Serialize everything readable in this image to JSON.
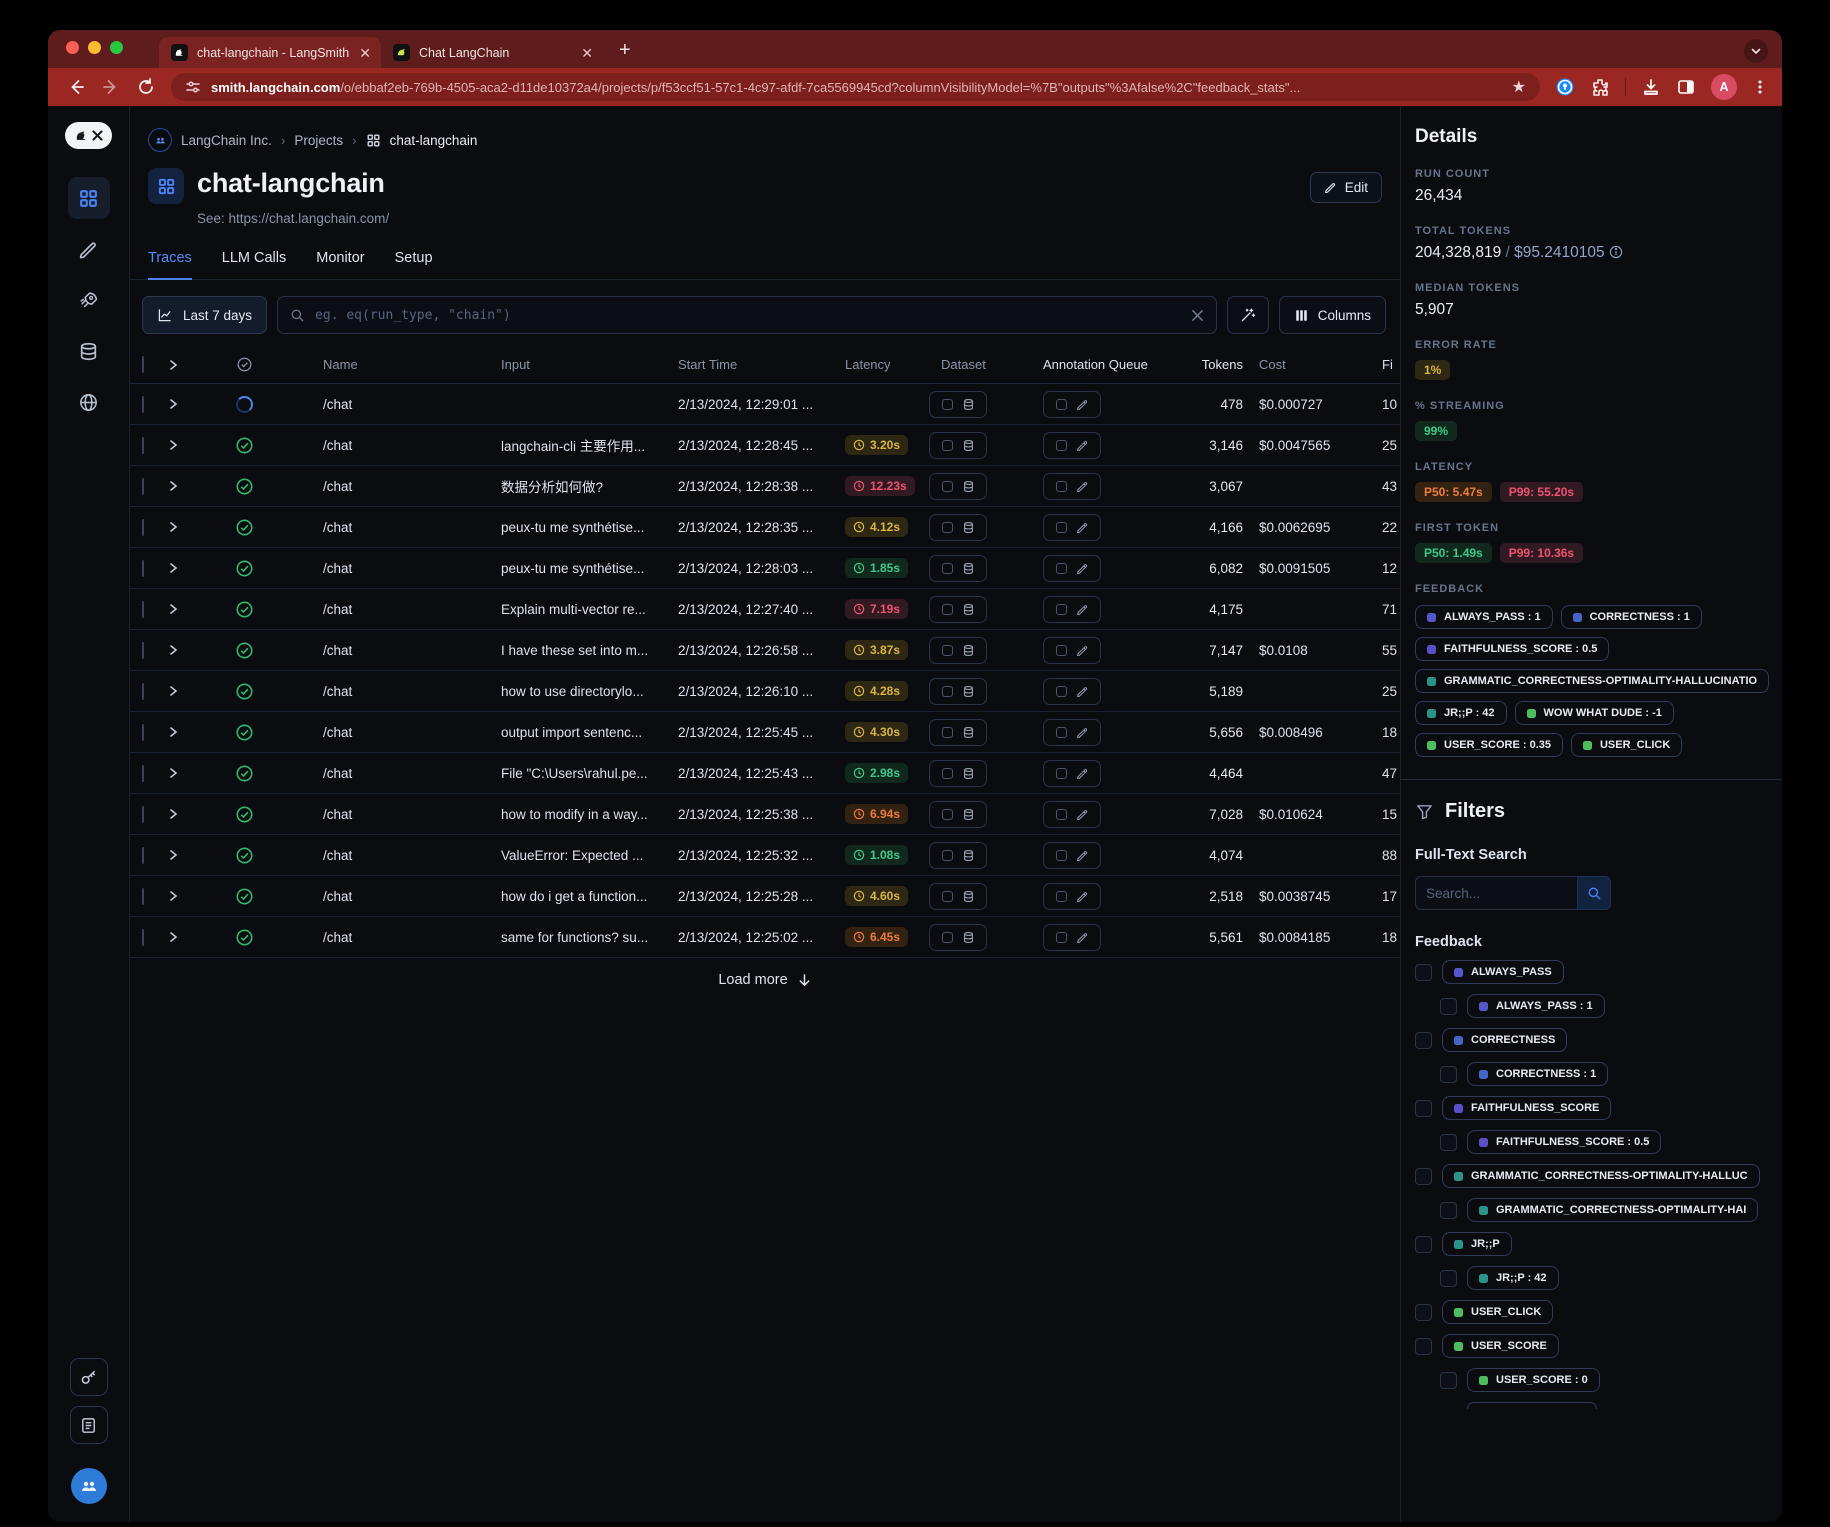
{
  "browser": {
    "tab1": "chat-langchain - LangSmith",
    "tab2": "Chat LangChain",
    "url_host": "smith.langchain.com",
    "url_path": "/o/ebbaf2eb-769b-4505-aca2-d11de10372a4/projects/p/f53ccf51-57c1-4c97-afdf-7ca5569945cd?columnVisibilityModel=%7B\"outputs\"%3Afalse%2C\"feedback_stats\"...",
    "avatar_initial": "A"
  },
  "breadcrumb": {
    "org": "LangChain Inc.",
    "section": "Projects",
    "current": "chat-langchain"
  },
  "header": {
    "title": "chat-langchain",
    "subtitle": "See: https://chat.langchain.com/",
    "edit_label": "Edit"
  },
  "nav_tabs": [
    {
      "label": "Traces"
    },
    {
      "label": "LLM Calls"
    },
    {
      "label": "Monitor"
    },
    {
      "label": "Setup"
    }
  ],
  "controls": {
    "time_range": "Last 7 days",
    "search_placeholder": "eg. eq(run_type, \"chain\")",
    "columns_label": "Columns"
  },
  "table": {
    "headers": [
      "Name",
      "Input",
      "Start Time",
      "Latency",
      "Dataset",
      "Annotation Queue",
      "Tokens",
      "Cost",
      "Fi"
    ],
    "load_more": "Load more",
    "rows": [
      {
        "status": "running",
        "name": "/chat",
        "input": "",
        "start": "2/13/2024, 12:29:01 ...",
        "latency": "",
        "latency_level": "",
        "tokens": "478",
        "cost": "$0.000727",
        "first": "10"
      },
      {
        "status": "success",
        "name": "/chat",
        "input": "langchain-cli 主要作用...",
        "start": "2/13/2024, 12:28:45 ...",
        "latency": "3.20s",
        "latency_level": "yellow",
        "tokens": "3,146",
        "cost": "$0.0047565",
        "first": "25"
      },
      {
        "status": "success",
        "name": "/chat",
        "input": "数据分析如何做?",
        "start": "2/13/2024, 12:28:38 ...",
        "latency": "12.23s",
        "latency_level": "red",
        "tokens": "3,067",
        "cost": "",
        "first": "43"
      },
      {
        "status": "success",
        "name": "/chat",
        "input": "peux-tu me synthétise...",
        "start": "2/13/2024, 12:28:35 ...",
        "latency": "4.12s",
        "latency_level": "yellow",
        "tokens": "4,166",
        "cost": "$0.0062695",
        "first": "22"
      },
      {
        "status": "success",
        "name": "/chat",
        "input": "peux-tu me synthétise...",
        "start": "2/13/2024, 12:28:03 ...",
        "latency": "1.85s",
        "latency_level": "green",
        "tokens": "6,082",
        "cost": "$0.0091505",
        "first": "12"
      },
      {
        "status": "success",
        "name": "/chat",
        "input": "Explain multi-vector re...",
        "start": "2/13/2024, 12:27:40 ...",
        "latency": "7.19s",
        "latency_level": "red",
        "tokens": "4,175",
        "cost": "",
        "first": "71"
      },
      {
        "status": "success",
        "name": "/chat",
        "input": "I have these set into m...",
        "start": "2/13/2024, 12:26:58 ...",
        "latency": "3.87s",
        "latency_level": "yellow",
        "tokens": "7,147",
        "cost": "$0.0108",
        "first": "55"
      },
      {
        "status": "success",
        "name": "/chat",
        "input": "how to use directorylo...",
        "start": "2/13/2024, 12:26:10 ...",
        "latency": "4.28s",
        "latency_level": "yellow",
        "tokens": "5,189",
        "cost": "",
        "first": "25"
      },
      {
        "status": "success",
        "name": "/chat",
        "input": "output import sentenc...",
        "start": "2/13/2024, 12:25:45 ...",
        "latency": "4.30s",
        "latency_level": "yellow",
        "tokens": "5,656",
        "cost": "$0.008496",
        "first": "18"
      },
      {
        "status": "success",
        "name": "/chat",
        "input": "File \"C:\\Users\\rahul.pe...",
        "start": "2/13/2024, 12:25:43 ...",
        "latency": "2.98s",
        "latency_level": "green",
        "tokens": "4,464",
        "cost": "",
        "first": "47"
      },
      {
        "status": "success",
        "name": "/chat",
        "input": "how to modify in a way...",
        "start": "2/13/2024, 12:25:38 ...",
        "latency": "6.94s",
        "latency_level": "orange",
        "tokens": "7,028",
        "cost": "$0.010624",
        "first": "15"
      },
      {
        "status": "success",
        "name": "/chat",
        "input": "ValueError: Expected ...",
        "start": "2/13/2024, 12:25:32 ...",
        "latency": "1.08s",
        "latency_level": "green",
        "tokens": "4,074",
        "cost": "",
        "first": "88"
      },
      {
        "status": "success",
        "name": "/chat",
        "input": "how do i get a function...",
        "start": "2/13/2024, 12:25:28 ...",
        "latency": "4.60s",
        "latency_level": "yellow",
        "tokens": "2,518",
        "cost": "$0.0038745",
        "first": "17"
      },
      {
        "status": "success",
        "name": "/chat",
        "input": "same for functions? su...",
        "start": "2/13/2024, 12:25:02 ...",
        "latency": "6.45s",
        "latency_level": "orange",
        "tokens": "5,561",
        "cost": "$0.0084185",
        "first": "18"
      }
    ]
  },
  "details": {
    "title": "Details",
    "run_count_label": "RUN COUNT",
    "run_count": "26,434",
    "total_tokens_label": "TOTAL TOKENS",
    "total_tokens": "204,328,819",
    "total_sep": " / ",
    "total_cost": "$95.2410105",
    "median_tokens_label": "MEDIAN TOKENS",
    "median_tokens": "5,907",
    "error_rate_label": "ERROR RATE",
    "error_rate": "1%",
    "streaming_label": "% STREAMING",
    "streaming": "99%",
    "latency_label": "LATENCY",
    "latency_p50": "P50: 5.47s",
    "latency_p99": "P99: 55.20s",
    "first_token_label": "FIRST TOKEN",
    "first_p50": "P50: 1.49s",
    "first_p99": "P99: 10.36s",
    "feedback_label": "FEEDBACK",
    "feedback": [
      {
        "label": "ALWAYS_PASS : 1",
        "color": "#5457c7"
      },
      {
        "label": "CORRECTNESS : 1",
        "color": "#4565c5"
      },
      {
        "label": "FAITHFULNESS_SCORE : 0.5",
        "color": "#5b4fc5"
      },
      {
        "label": "GRAMMATIC_CORRECTNESS-OPTIMALITY-HALLUCINATIO",
        "color": "#2b9488"
      },
      {
        "label": "JR;;P : 42",
        "color": "#2b9488"
      },
      {
        "label": "WOW WHAT DUDE : -1",
        "color": "#4fbd5f"
      },
      {
        "label": "USER_SCORE : 0.35",
        "color": "#4fbd5f"
      },
      {
        "label": "USER_CLICK",
        "color": "#4fbd5f"
      }
    ]
  },
  "filters": {
    "title": "Filters",
    "full_text_label": "Full-Text Search",
    "search_placeholder": "Search...",
    "feedback_label": "Feedback",
    "items": [
      {
        "label": "ALWAYS_PASS",
        "color": "#5457c7",
        "indent": false
      },
      {
        "label": "ALWAYS_PASS : 1",
        "color": "#5457c7",
        "indent": true
      },
      {
        "label": "CORRECTNESS",
        "color": "#4565c5",
        "indent": false
      },
      {
        "label": "CORRECTNESS : 1",
        "color": "#4565c5",
        "indent": true
      },
      {
        "label": "FAITHFULNESS_SCORE",
        "color": "#5b4fc5",
        "indent": false
      },
      {
        "label": "FAITHFULNESS_SCORE : 0.5",
        "color": "#5b4fc5",
        "indent": true
      },
      {
        "label": "GRAMMATIC_CORRECTNESS-OPTIMALITY-HALLUC",
        "color": "#2b9488",
        "indent": false
      },
      {
        "label": "GRAMMATIC_CORRECTNESS-OPTIMALITY-HAI",
        "color": "#2b9488",
        "indent": true
      },
      {
        "label": "JR;;P",
        "color": "#2b9488",
        "indent": false
      },
      {
        "label": "JR;;P : 42",
        "color": "#2b9488",
        "indent": true
      },
      {
        "label": "USER_CLICK",
        "color": "#4fbd5f",
        "indent": false
      },
      {
        "label": "USER_SCORE",
        "color": "#4fbd5f",
        "indent": false
      },
      {
        "label": "USER_SCORE : 0",
        "color": "#4fbd5f",
        "indent": true
      }
    ]
  },
  "colors": {
    "accent_blue": "#4d82f5",
    "success_green": "#2fb871",
    "brand_red_toolbar": "#9b2723"
  }
}
